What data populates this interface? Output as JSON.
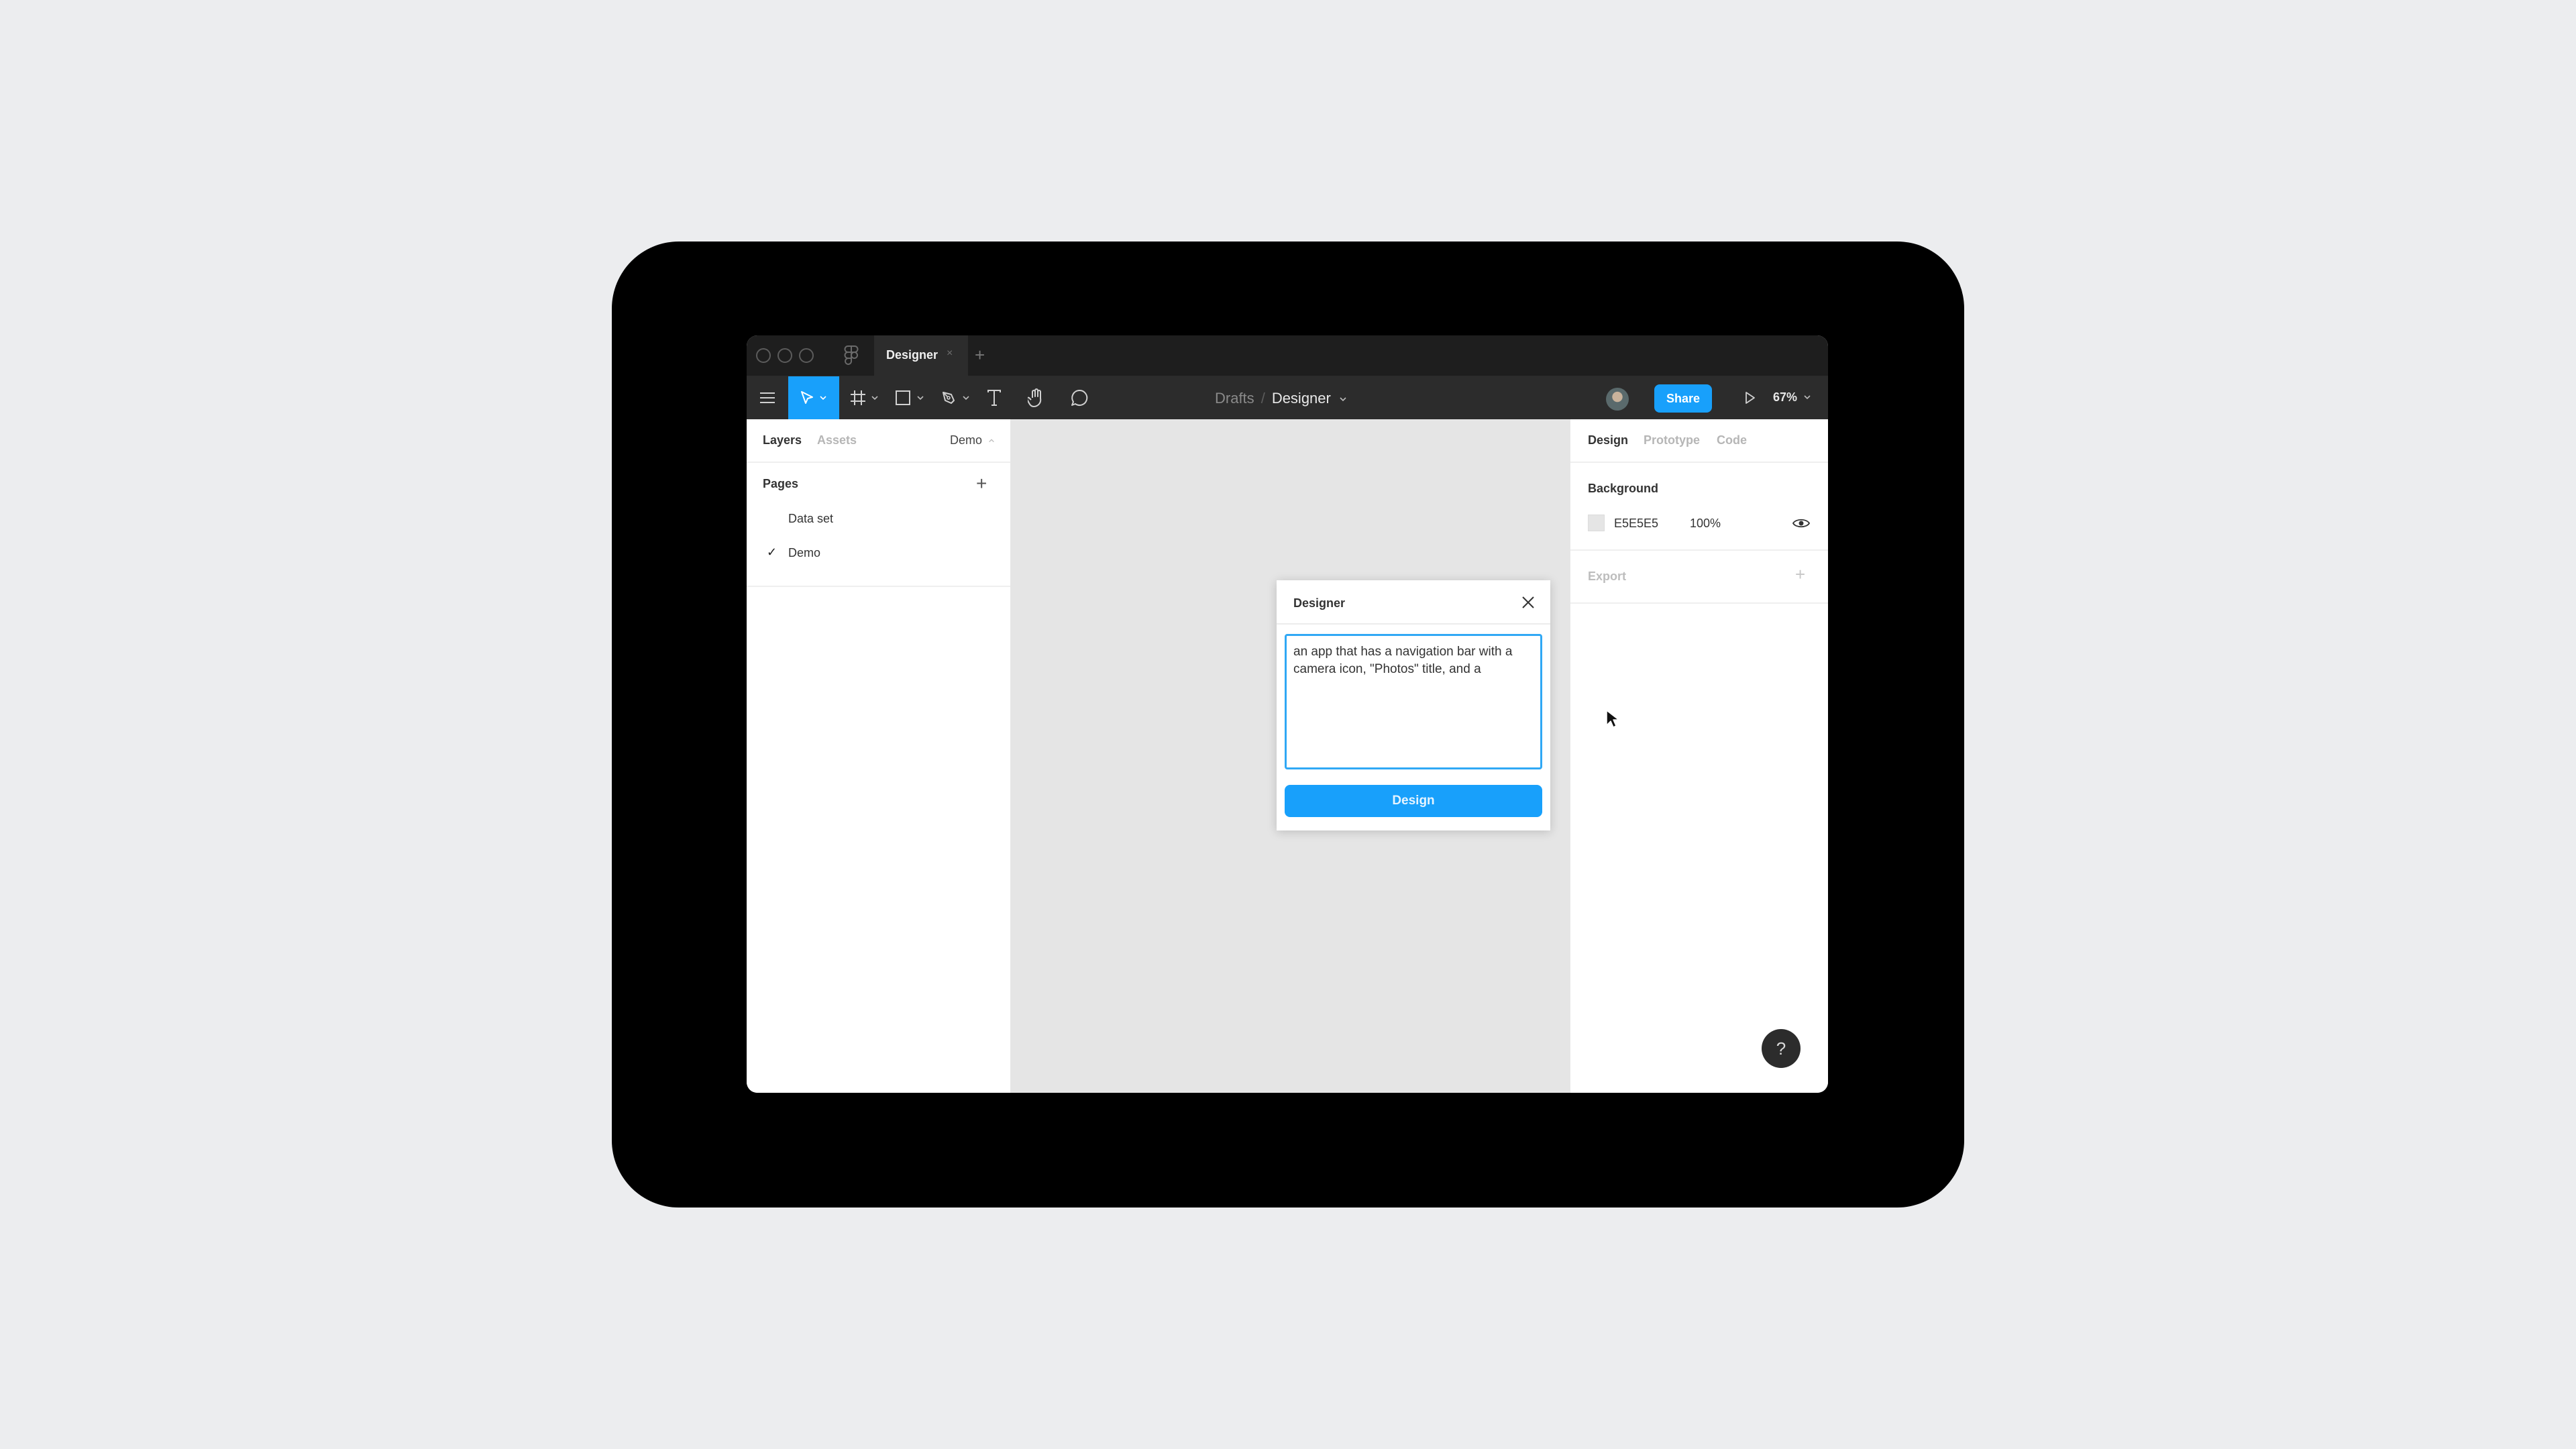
{
  "window": {
    "tab_title": "Designer",
    "tab_close": "×",
    "tab_add": "+"
  },
  "toolbar": {
    "tools": [
      {
        "name": "menu",
        "icon": "hamburger-menu-icon"
      },
      {
        "name": "move",
        "icon": "move-pointer-icon",
        "active": true
      },
      {
        "name": "frame",
        "icon": "frame-hash-icon"
      },
      {
        "name": "shape",
        "icon": "rectangle-icon"
      },
      {
        "name": "pen",
        "icon": "pen-nib-icon"
      },
      {
        "name": "text",
        "icon": "text-T-icon"
      },
      {
        "name": "hand",
        "icon": "hand-icon"
      },
      {
        "name": "comment",
        "icon": "comment-bubble-icon"
      }
    ],
    "breadcrumb_parent": "Drafts",
    "breadcrumb_separator": "/",
    "file_name": "Designer",
    "share_label": "Share",
    "zoom_level": "67%",
    "accent_color": "#18A0FB"
  },
  "left_panel": {
    "tab_layers": "Layers",
    "tab_assets": "Assets",
    "current_page": "Demo",
    "pages_title": "Pages",
    "add_page": "+",
    "pages": [
      {
        "label": "Data set",
        "selected": false
      },
      {
        "label": "Demo",
        "selected": true,
        "check": "✓"
      }
    ]
  },
  "right_panel": {
    "tab_design": "Design",
    "tab_prototype": "Prototype",
    "tab_code": "Code",
    "background_title": "Background",
    "background_hex": "E5E5E5",
    "background_opacity": "100%",
    "background_color": "#E5E5E5",
    "export_title": "Export",
    "export_add": "+",
    "help": "?"
  },
  "dialog": {
    "title": "Designer",
    "prompt_value": "an app that has a navigation bar with a camera icon, \"Photos\" title, and a",
    "button_label": "Design"
  }
}
